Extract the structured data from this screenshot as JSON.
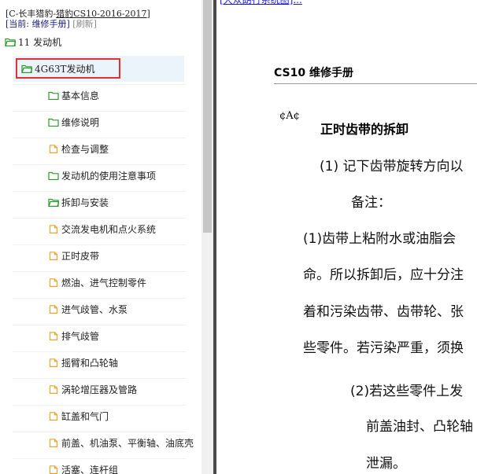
{
  "tree": {
    "title_prefix": "[C-长丰猎豹-",
    "title_link": "猎豹CS10-2016-2017",
    "title_suffix": "]",
    "current_label": "[当前: 维修手册]",
    "refresh_label": "[刷新]",
    "root_label": "11 发动机",
    "engine_label": "4G63T发动机",
    "items": [
      {
        "label": "基本信息",
        "icon": "folder-icon"
      },
      {
        "label": "维修说明",
        "icon": "folder-icon"
      },
      {
        "label": "检查与调整",
        "icon": "document-icon"
      },
      {
        "label": "发动机的使用注意事项",
        "icon": "folder-icon"
      },
      {
        "label": "拆卸与安装",
        "icon": "folder-open-icon"
      },
      {
        "label": "交流发电机和点火系统",
        "icon": "document-icon"
      },
      {
        "label": "正时皮带",
        "icon": "document-icon"
      },
      {
        "label": "燃油、进气控制零件",
        "icon": "document-icon"
      },
      {
        "label": "进气歧管、水泵",
        "icon": "document-icon"
      },
      {
        "label": "排气歧管",
        "icon": "document-icon"
      },
      {
        "label": "摇臂和凸轮轴",
        "icon": "document-icon"
      },
      {
        "label": "涡轮增压器及管路",
        "icon": "document-icon"
      },
      {
        "label": "缸盖和气门",
        "icon": "document-icon"
      },
      {
        "label": "前盖、机油泵、平衡轴、油底壳",
        "icon": "document-icon"
      },
      {
        "label": "活塞、连杆组",
        "icon": "document-icon"
      }
    ]
  },
  "doc": {
    "top_link": "[大众朗行系统图]...",
    "header": "CS10 维修手册",
    "marker": "¢A¢",
    "section_title": "正时齿带的拆卸",
    "lines": [
      "(1) 记下齿带旋转方向以",
      "备注：",
      "(1)齿带上粘附水或油脂会",
      "命。所以拆卸后，应十分注",
      "着和污染齿带、齿带轮、张",
      "些零件。若污染严重，须换",
      "(2)若这些零件上发",
      "前盖油封、凸轮轴",
      "泄漏。"
    ]
  },
  "colors": {
    "highlight_border": "#e23131",
    "selected_bg": "#ebf3fb",
    "folder_green": "#2e9a2e",
    "document_orange": "#f0a22a"
  }
}
